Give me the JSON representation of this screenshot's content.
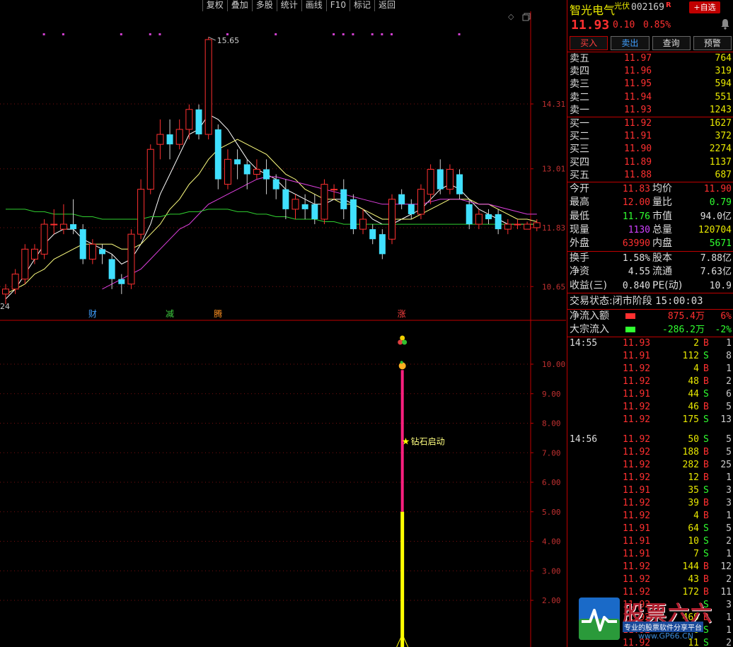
{
  "toolbar": {
    "buttons": [
      "复权",
      "叠加",
      "多股",
      "统计",
      "画线",
      "F10",
      "标记",
      "返回"
    ]
  },
  "stock": {
    "name": "智光电气",
    "tag": "光伏",
    "code": "002169",
    "margin_flag": "R",
    "add_favorite": "+自选",
    "last_price": "11.93",
    "change": "0.10",
    "change_pct": "0.85%"
  },
  "trade_buttons": [
    "买入",
    "卖出",
    "查询",
    "预警"
  ],
  "order_book": {
    "asks": [
      {
        "label": "卖五",
        "price": "11.97",
        "vol": "764"
      },
      {
        "label": "卖四",
        "price": "11.96",
        "vol": "319"
      },
      {
        "label": "卖三",
        "price": "11.95",
        "vol": "594"
      },
      {
        "label": "卖二",
        "price": "11.94",
        "vol": "551"
      },
      {
        "label": "卖一",
        "price": "11.93",
        "vol": "1243"
      }
    ],
    "bids": [
      {
        "label": "买一",
        "price": "11.92",
        "vol": "1627"
      },
      {
        "label": "买二",
        "price": "11.91",
        "vol": "372"
      },
      {
        "label": "买三",
        "price": "11.90",
        "vol": "2274"
      },
      {
        "label": "买四",
        "price": "11.89",
        "vol": "1137"
      },
      {
        "label": "买五",
        "price": "11.88",
        "vol": "687"
      }
    ]
  },
  "stats": {
    "block1": [
      {
        "l1": "今开",
        "v1": "11.83",
        "c1": "#ff3030",
        "l2": "均价",
        "v2": "11.90",
        "c2": "#ff3030"
      },
      {
        "l1": "最高",
        "v1": "12.00",
        "c1": "#ff3030",
        "l2": "量比",
        "v2": "0.79",
        "c2": "#30ff30"
      },
      {
        "l1": "最低",
        "v1": "11.76",
        "c1": "#30ff30",
        "l2": "市值",
        "v2": "94.0亿",
        "c2": "#e0e0e0"
      },
      {
        "l1": "现量",
        "v1": "1130",
        "c1": "#d040ff",
        "l2": "总量",
        "v2": "120704",
        "c2": "#e8e800"
      },
      {
        "l1": "外盘",
        "v1": "63990",
        "c1": "#ff3030",
        "l2": "内盘",
        "v2": "5671",
        "c2": "#30ff30"
      }
    ],
    "block2": [
      {
        "l1": "换手",
        "v1": "1.58%",
        "c1": "#e0e0e0",
        "l2": "股本",
        "v2": "7.88亿",
        "c2": "#e0e0e0"
      },
      {
        "l1": "净资",
        "v1": "4.55",
        "c1": "#e0e0e0",
        "l2": "流通",
        "v2": "7.63亿",
        "c2": "#e0e0e0"
      },
      {
        "l1": "收益(三)",
        "v1": "0.840",
        "c1": "#e0e0e0",
        "l2": "PE(动)",
        "v2": "10.9",
        "c2": "#e0e0e0"
      }
    ]
  },
  "trade_status": {
    "label": "交易状态:",
    "state": "闭市阶段",
    "time": "15:00:03"
  },
  "flows": [
    {
      "label": "净流入额",
      "value": "875.4万",
      "pct": "6%",
      "color": "#ff3030"
    },
    {
      "label": "大宗流入",
      "value": "-286.2万",
      "pct": "-2%",
      "color": "#30ff30"
    }
  ],
  "ticks": [
    {
      "time": "14:55",
      "price": "11.93",
      "vol": "2",
      "side": "B",
      "cnt": "1"
    },
    {
      "time": "",
      "price": "11.91",
      "vol": "112",
      "side": "S",
      "cnt": "8"
    },
    {
      "time": "",
      "price": "11.92",
      "vol": "4",
      "side": "B",
      "cnt": "1"
    },
    {
      "time": "",
      "price": "11.92",
      "vol": "48",
      "side": "B",
      "cnt": "2"
    },
    {
      "time": "",
      "price": "11.91",
      "vol": "44",
      "side": "S",
      "cnt": "6"
    },
    {
      "time": "",
      "price": "11.92",
      "vol": "46",
      "side": "B",
      "cnt": "5"
    },
    {
      "time": "",
      "price": "11.92",
      "vol": "175",
      "side": "S",
      "cnt": "13"
    },
    {
      "gap": true
    },
    {
      "time": "14:56",
      "price": "11.92",
      "vol": "50",
      "side": "S",
      "cnt": "5"
    },
    {
      "time": "",
      "price": "11.92",
      "vol": "188",
      "side": "B",
      "cnt": "5"
    },
    {
      "time": "",
      "price": "11.92",
      "vol": "282",
      "side": "B",
      "cnt": "25"
    },
    {
      "time": "",
      "price": "11.92",
      "vol": "12",
      "side": "B",
      "cnt": "1"
    },
    {
      "time": "",
      "price": "11.91",
      "vol": "35",
      "side": "S",
      "cnt": "3"
    },
    {
      "time": "",
      "price": "11.92",
      "vol": "39",
      "side": "B",
      "cnt": "3"
    },
    {
      "time": "",
      "price": "11.92",
      "vol": "4",
      "side": "B",
      "cnt": "1"
    },
    {
      "time": "",
      "price": "11.91",
      "vol": "64",
      "side": "S",
      "cnt": "5"
    },
    {
      "time": "",
      "price": "11.91",
      "vol": "10",
      "side": "S",
      "cnt": "2"
    },
    {
      "time": "",
      "price": "11.91",
      "vol": "7",
      "side": "S",
      "cnt": "1"
    },
    {
      "time": "",
      "price": "11.92",
      "vol": "144",
      "side": "B",
      "cnt": "12"
    },
    {
      "time": "",
      "price": "11.92",
      "vol": "43",
      "side": "B",
      "cnt": "2"
    },
    {
      "time": "",
      "price": "11.92",
      "vol": "172",
      "side": "B",
      "cnt": "11"
    },
    {
      "time": "",
      "price": "11.92",
      "vol": "",
      "side": "S",
      "cnt": "3"
    },
    {
      "time": "",
      "price": "11.92",
      "vol": "469",
      "side": "B",
      "cnt": "1"
    },
    {
      "time": "",
      "price": "11.92",
      "vol": "6",
      "side": "S",
      "cnt": "1"
    },
    {
      "time": "",
      "price": "11.92",
      "vol": "11",
      "side": "S",
      "cnt": "2"
    }
  ],
  "watermark": {
    "title": "股票六六",
    "slogan": "专业的股票软件分享平台",
    "url": "www.GP66.CN"
  },
  "colors": {
    "up": "#ff3030",
    "down": "#40e0ff",
    "ma5": "#ffffff",
    "ma10": "#ffff80",
    "ma20": "#e040e0",
    "ma60": "#30d030",
    "grid": "#7a1010",
    "axis_text": "#c03030",
    "magenta_bar": "#ff2080",
    "yellow_bar": "#ffff00"
  },
  "chart_data": [
    {
      "type": "candlestick",
      "title": "",
      "ylim": [
        10.2,
        16.0
      ],
      "y_ticks": [
        "14.31",
        "13.01",
        "11.83",
        "10.65"
      ],
      "peak_label": "15.65",
      "left_edge_label": "24",
      "event_markers": [
        {
          "label": "财",
          "index": 9
        },
        {
          "label": "减",
          "index": 17
        },
        {
          "label": "腾",
          "index": 22
        },
        {
          "label": "涨",
          "index": 41
        }
      ],
      "candles": [
        [
          10.5,
          10.6,
          10.3,
          10.7
        ],
        [
          10.6,
          10.9,
          10.5,
          11.0
        ],
        [
          10.8,
          11.4,
          10.7,
          11.5
        ],
        [
          11.2,
          11.4,
          11.1,
          11.5
        ],
        [
          11.3,
          11.9,
          11.2,
          12.0
        ],
        [
          11.9,
          11.9,
          11.7,
          12.2
        ],
        [
          11.8,
          11.9,
          11.7,
          12.3
        ],
        [
          11.9,
          11.8,
          11.7,
          12.4
        ],
        [
          11.8,
          11.2,
          11.1,
          11.9
        ],
        [
          11.2,
          11.5,
          11.1,
          11.6
        ],
        [
          11.4,
          11.3,
          11.1,
          11.5
        ],
        [
          11.2,
          10.8,
          10.6,
          11.3
        ],
        [
          10.8,
          10.7,
          10.5,
          10.9
        ],
        [
          10.7,
          11.7,
          10.6,
          11.8
        ],
        [
          11.7,
          12.6,
          11.6,
          12.8
        ],
        [
          12.6,
          13.4,
          12.5,
          13.5
        ],
        [
          13.5,
          13.7,
          13.2,
          14.0
        ],
        [
          13.7,
          13.5,
          13.2,
          14.0
        ],
        [
          13.5,
          13.8,
          13.4,
          14.0
        ],
        [
          13.8,
          14.2,
          13.6,
          14.3
        ],
        [
          14.2,
          13.7,
          13.6,
          14.3
        ],
        [
          13.7,
          15.6,
          13.6,
          15.65
        ],
        [
          13.8,
          12.8,
          12.6,
          13.9
        ],
        [
          12.7,
          13.2,
          12.6,
          13.4
        ],
        [
          13.2,
          13.1,
          12.8,
          13.4
        ],
        [
          13.1,
          12.9,
          12.6,
          13.2
        ],
        [
          12.9,
          13.0,
          12.8,
          13.2
        ],
        [
          13.0,
          12.8,
          12.5,
          13.2
        ],
        [
          12.8,
          12.6,
          12.4,
          12.9
        ],
        [
          12.6,
          12.2,
          12.0,
          12.8
        ],
        [
          12.2,
          12.4,
          12.0,
          12.5
        ],
        [
          12.3,
          12.2,
          12.0,
          12.5
        ],
        [
          12.3,
          12.0,
          11.9,
          12.5
        ],
        [
          12.0,
          12.7,
          11.9,
          12.8
        ],
        [
          12.6,
          12.6,
          12.4,
          12.7
        ],
        [
          12.6,
          12.2,
          12.0,
          12.8
        ],
        [
          12.4,
          11.8,
          11.7,
          12.5
        ],
        [
          11.8,
          12.0,
          11.7,
          12.2
        ],
        [
          11.8,
          11.6,
          11.5,
          11.9
        ],
        [
          11.7,
          11.3,
          11.2,
          11.8
        ],
        [
          11.6,
          12.4,
          11.5,
          12.5
        ],
        [
          12.5,
          12.3,
          12.2,
          12.6
        ],
        [
          12.3,
          12.1,
          12.0,
          12.4
        ],
        [
          12.1,
          12.6,
          12.0,
          12.7
        ],
        [
          12.5,
          13.0,
          12.3,
          13.1
        ],
        [
          13.0,
          12.6,
          12.5,
          13.2
        ],
        [
          12.6,
          13.0,
          12.5,
          13.1
        ],
        [
          12.9,
          12.5,
          12.4,
          13.0
        ],
        [
          12.3,
          11.9,
          11.8,
          12.4
        ],
        [
          11.9,
          12.1,
          11.8,
          12.2
        ],
        [
          12.1,
          12.0,
          11.9,
          12.2
        ],
        [
          12.1,
          11.8,
          11.7,
          12.2
        ],
        [
          11.8,
          11.9,
          11.7,
          12.0
        ],
        [
          11.9,
          11.9,
          11.8,
          12.0
        ],
        [
          11.8,
          11.9,
          11.8,
          11.95
        ],
        [
          11.83,
          11.93,
          11.76,
          12.0
        ]
      ],
      "ma_series": [
        {
          "name": "MA5",
          "values": [
            10.4,
            10.6,
            10.9,
            11.2,
            11.5,
            11.7,
            11.8,
            11.8,
            11.6,
            11.5,
            11.4,
            11.3,
            11.1,
            11.2,
            11.5,
            11.9,
            12.5,
            12.9,
            13.3,
            13.7,
            13.8,
            14.1,
            14.0,
            13.8,
            13.5,
            13.2,
            13.0,
            12.9,
            12.8,
            12.6,
            12.5,
            12.4,
            12.3,
            12.3,
            12.4,
            12.4,
            12.3,
            12.2,
            12.0,
            11.9,
            11.9,
            12.0,
            12.1,
            12.2,
            12.4,
            12.6,
            12.7,
            12.6,
            12.4,
            12.2,
            12.1,
            12.0,
            11.9,
            11.9,
            11.9,
            11.9
          ]
        },
        {
          "name": "MA10",
          "values": [
            10.5,
            10.6,
            10.7,
            10.9,
            11.0,
            11.2,
            11.3,
            11.4,
            11.5,
            11.5,
            11.5,
            11.5,
            11.4,
            11.4,
            11.5,
            11.7,
            11.9,
            12.2,
            12.4,
            12.7,
            12.9,
            13.2,
            13.4,
            13.5,
            13.6,
            13.5,
            13.4,
            13.3,
            13.1,
            12.9,
            12.8,
            12.6,
            12.5,
            12.4,
            12.4,
            12.3,
            12.3,
            12.2,
            12.1,
            12.0,
            12.0,
            12.0,
            12.0,
            12.1,
            12.2,
            12.3,
            12.4,
            12.4,
            12.4,
            12.3,
            12.3,
            12.2,
            12.1,
            12.0,
            12.0,
            11.95
          ]
        },
        {
          "name": "MA20",
          "values": [
            null,
            null,
            null,
            null,
            null,
            null,
            null,
            null,
            null,
            null,
            10.6,
            10.7,
            10.8,
            10.9,
            11.0,
            11.2,
            11.4,
            11.6,
            11.8,
            11.9,
            12.1,
            12.3,
            12.4,
            12.5,
            12.6,
            12.7,
            12.8,
            12.85,
            12.85,
            12.8,
            12.75,
            12.7,
            12.65,
            12.6,
            12.55,
            12.5,
            12.45,
            12.4,
            12.35,
            12.3,
            12.3,
            12.3,
            12.3,
            12.3,
            12.35,
            12.4,
            12.4,
            12.4,
            12.35,
            12.3,
            12.3,
            12.25,
            12.2,
            12.15,
            12.1,
            12.1
          ]
        },
        {
          "name": "MA60",
          "values": [
            12.2,
            12.2,
            12.2,
            12.15,
            12.15,
            12.1,
            12.1,
            12.1,
            12.05,
            12.05,
            12.0,
            12.0,
            12.0,
            12.0,
            12.0,
            12.05,
            12.05,
            12.1,
            12.1,
            12.15,
            12.15,
            12.2,
            12.2,
            12.2,
            12.15,
            12.15,
            12.1,
            12.1,
            12.05,
            12.05,
            12.0,
            12.0,
            12.0,
            11.95,
            11.95,
            11.9,
            11.9,
            11.9,
            11.9,
            11.9,
            11.9,
            11.9,
            11.9,
            11.9,
            11.9,
            11.9,
            11.9,
            11.9,
            11.9,
            11.9,
            11.9,
            11.9,
            11.9,
            11.9,
            11.9,
            11.9
          ]
        }
      ]
    },
    {
      "type": "bar",
      "title": "",
      "ylim": [
        0,
        11
      ],
      "y_ticks": [
        "10.00",
        "9.00",
        "8.00",
        "7.00",
        "6.00",
        "5.00",
        "4.00",
        "3.00",
        "2.00"
      ],
      "signal_index": 41,
      "magenta_value": 9.8,
      "yellow_value": 5.0,
      "annotation": "钻石启动",
      "annotation_value": 7.4
    }
  ]
}
